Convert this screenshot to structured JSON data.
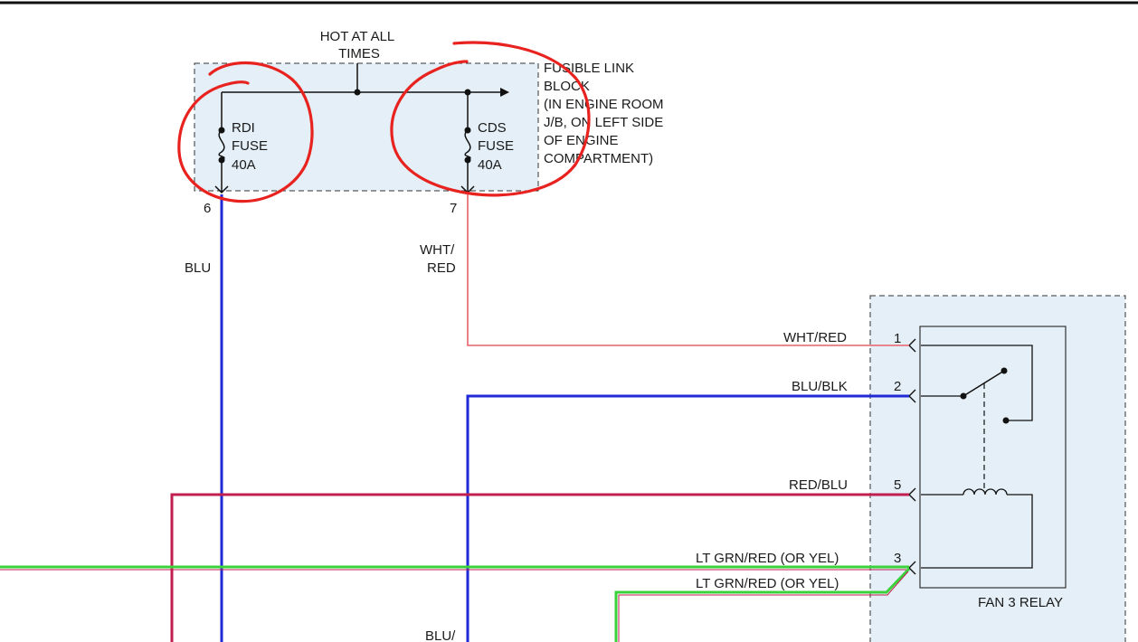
{
  "fusible_block": {
    "hot_label_line1": "HOT AT ALL",
    "hot_label_line2": "TIMES",
    "title_lines": [
      "FUSIBLE LINK",
      "BLOCK",
      "(IN ENGINE ROOM",
      "J/B, ON LEFT SIDE",
      "OF ENGINE",
      "COMPARTMENT)"
    ],
    "rdi_fuse": {
      "lines": [
        "RDI",
        "FUSE",
        "40A"
      ],
      "pin": "6"
    },
    "cds_fuse": {
      "lines": [
        "CDS",
        "FUSE",
        "40A"
      ],
      "pin": "7"
    }
  },
  "wires": {
    "blu": "BLU",
    "wht_red_vertical": [
      "WHT/",
      "RED"
    ],
    "blu_bottom": "BLU/",
    "wht_red": "WHT/RED",
    "blu_blk": "BLU/BLK",
    "red_blu": "RED/BLU",
    "lt_grn_red_1": "LT GRN/RED (OR YEL)",
    "lt_grn_red_2": "LT GRN/RED (OR YEL)"
  },
  "relay": {
    "title": "FAN 3 RELAY",
    "pins": [
      "1",
      "2",
      "5",
      "3"
    ]
  },
  "colors": {
    "panel_fill": "#e4eff7",
    "blu_wire": "#1f2ad6",
    "red_wire": "#e23a3a",
    "red_blu_wire": "#c21e4f",
    "green_wire": "#3ad13a",
    "annotation": "#e8231f"
  }
}
